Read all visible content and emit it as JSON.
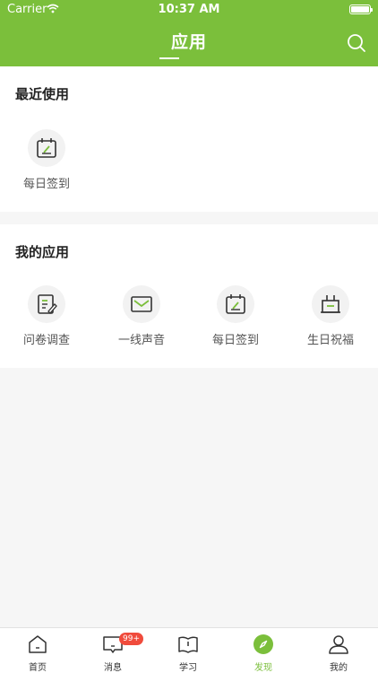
{
  "status_bar": {
    "carrier": "Carrier",
    "time": "10:37 AM"
  },
  "header": {
    "title": "应用"
  },
  "recent": {
    "title": "最近使用",
    "items": [
      {
        "label": "每日签到",
        "icon": "checkin-calendar-icon"
      }
    ]
  },
  "my_apps": {
    "title": "我的应用",
    "items": [
      {
        "label": "问卷调查",
        "icon": "survey-icon"
      },
      {
        "label": "一线声音",
        "icon": "mail-icon"
      },
      {
        "label": "每日签到",
        "icon": "checkin-calendar-icon"
      },
      {
        "label": "生日祝福",
        "icon": "birthday-cake-icon"
      }
    ]
  },
  "tabbar": {
    "items": [
      {
        "label": "首页",
        "icon": "home-icon"
      },
      {
        "label": "消息",
        "icon": "message-icon",
        "badge": "99+"
      },
      {
        "label": "学习",
        "icon": "book-icon"
      },
      {
        "label": "发现",
        "icon": "compass-icon",
        "active": true
      },
      {
        "label": "我的",
        "icon": "user-icon"
      }
    ]
  },
  "colors": {
    "accent": "#7bbf3b",
    "badge": "#f04b3c"
  }
}
